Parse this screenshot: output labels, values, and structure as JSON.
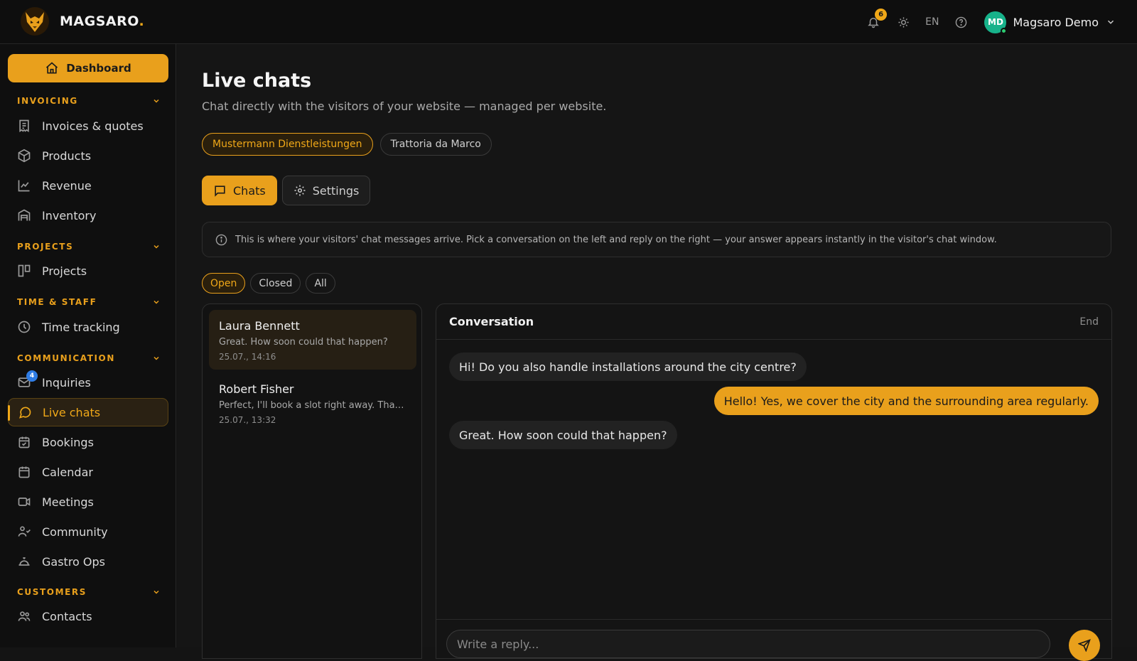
{
  "brand": {
    "name": "MAGSARO",
    "dot": "."
  },
  "topbar": {
    "notification_count": "6",
    "language": "EN",
    "user_initials": "MD",
    "user_name": "Magsaro Demo"
  },
  "sidebar": {
    "dashboard_label": "Dashboard",
    "sections": {
      "invoicing": "INVOICING",
      "projects": "PROJECTS",
      "time_staff": "TIME & STAFF",
      "communication": "COMMUNICATION",
      "customers": "CUSTOMERS"
    },
    "items": {
      "invoices": "Invoices & quotes",
      "products": "Products",
      "revenue": "Revenue",
      "inventory": "Inventory",
      "projects": "Projects",
      "time_tracking": "Time tracking",
      "inquiries": "Inquiries",
      "inquiries_badge": "4",
      "live_chats": "Live chats",
      "bookings": "Bookings",
      "calendar": "Calendar",
      "meetings": "Meetings",
      "community": "Community",
      "gastro_ops": "Gastro Ops",
      "contacts": "Contacts"
    }
  },
  "main": {
    "title": "Live chats",
    "subtitle": "Chat directly with the visitors of your website — managed per website.",
    "sites": [
      "Mustermann Dienstleistungen",
      "Trattoria da Marco"
    ],
    "tabs": {
      "chats": "Chats",
      "settings": "Settings"
    },
    "info": "This is where your visitors' chat messages arrive. Pick a conversation on the left and reply on the right — your answer appears instantly in the visitor's chat window.",
    "filters": [
      "Open",
      "Closed",
      "All"
    ],
    "chats": [
      {
        "name": "Laura Bennett",
        "preview": "Great. How soon could that happen?",
        "time": "25.07., 14:16"
      },
      {
        "name": "Robert Fisher",
        "preview": "Perfect, I'll book a slot right away. Than...",
        "time": "25.07., 13:32"
      }
    ],
    "conversation": {
      "title": "Conversation",
      "end_label": "End",
      "messages": [
        {
          "text": "Hi! Do you also handle installations around the city centre?"
        },
        {
          "text": "Hello! Yes, we cover the city and the surrounding area regularly."
        },
        {
          "text": "Great. How soon could that happen?"
        }
      ],
      "reply_placeholder": "Write a reply..."
    }
  }
}
